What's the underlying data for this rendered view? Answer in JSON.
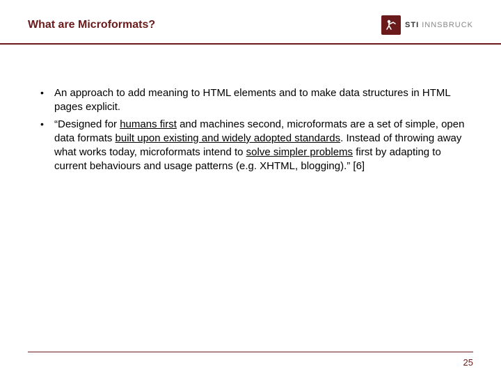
{
  "header": {
    "title": "What are Microformats?",
    "logo": {
      "bold": "STI",
      "light": " INNSBRUCK"
    }
  },
  "bullets": [
    {
      "segments": [
        {
          "text": "An approach to add meaning to HTML elements and to make data structures in HTML pages explicit.",
          "u": false
        }
      ]
    },
    {
      "segments": [
        {
          "text": "“Designed for ",
          "u": false
        },
        {
          "text": "humans first",
          "u": true
        },
        {
          "text": " and machines second, microformats are a set of simple, open data formats ",
          "u": false
        },
        {
          "text": "built upon existing and widely adopted standards",
          "u": true
        },
        {
          "text": ". Instead of throwing away what works today, microformats intend to ",
          "u": false
        },
        {
          "text": "solve simpler problems",
          "u": true
        },
        {
          "text": " first by adapting to current behaviours and usage patterns (e.g. XHTML, blogging).” [6]",
          "u": false
        }
      ]
    }
  ],
  "pageNumber": "25"
}
